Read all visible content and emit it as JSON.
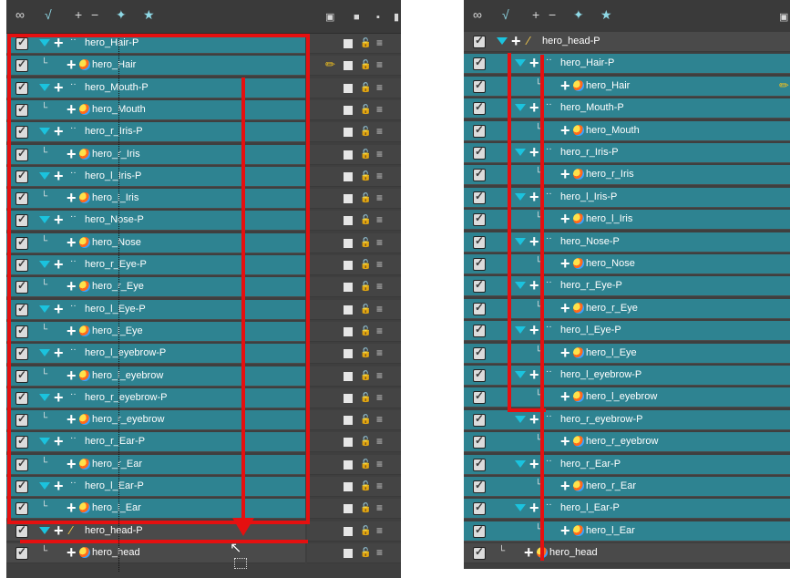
{
  "left": {
    "toolbar": {
      "icons": [
        "onion-skin-icon",
        "lightbox-icon",
        "add-layer-icon",
        "delete-layer-icon",
        "add-peg-icon",
        "add-drawing-icon"
      ],
      "right_icons": [
        "camera-view-icon",
        "display-icon",
        "small-square-icon",
        "layer-color-icon",
        "back-arrow-icon"
      ]
    },
    "rows": [
      {
        "name": "hero_Hair-P",
        "type": "peg"
      },
      {
        "name": "hero_Hair",
        "type": "drawing",
        "selected": true
      },
      {
        "name": "hero_Mouth-P",
        "type": "peg"
      },
      {
        "name": "hero_Mouth",
        "type": "drawing"
      },
      {
        "name": "hero_r_Iris-P",
        "type": "peg"
      },
      {
        "name": "hero_r_Iris",
        "type": "drawing"
      },
      {
        "name": "hero_l_Iris-P",
        "type": "peg"
      },
      {
        "name": "hero_l_Iris",
        "type": "drawing"
      },
      {
        "name": "hero_Nose-P",
        "type": "peg"
      },
      {
        "name": "hero_Nose",
        "type": "drawing"
      },
      {
        "name": "hero_r_Eye-P",
        "type": "peg"
      },
      {
        "name": "hero_r_Eye",
        "type": "drawing"
      },
      {
        "name": "hero_l_Eye-P",
        "type": "peg"
      },
      {
        "name": "hero_l_Eye",
        "type": "drawing"
      },
      {
        "name": "hero_l_eyebrow-P",
        "type": "peg"
      },
      {
        "name": "hero_l_eyebrow",
        "type": "drawing"
      },
      {
        "name": "hero_r_eyebrow-P",
        "type": "peg"
      },
      {
        "name": "hero_r_eyebrow",
        "type": "drawing"
      },
      {
        "name": "hero_r_Ear-P",
        "type": "peg"
      },
      {
        "name": "hero_r_Ear",
        "type": "drawing"
      },
      {
        "name": "hero_l_Ear-P",
        "type": "peg"
      },
      {
        "name": "hero_l_Ear",
        "type": "drawing"
      },
      {
        "name": "hero_head-P",
        "type": "head-peg"
      },
      {
        "name": "hero_head",
        "type": "drawing-dark"
      }
    ]
  },
  "right": {
    "toolbar": {
      "icons": [
        "onion-skin-icon",
        "lightbox-icon",
        "add-layer-icon",
        "delete-layer-icon",
        "add-peg-icon",
        "add-drawing-icon",
        "camera-view-icon"
      ]
    },
    "rows": [
      {
        "name": "hero_head-P",
        "type": "head-peg",
        "depth": 0
      },
      {
        "name": "hero_Hair-P",
        "type": "peg",
        "depth": 1
      },
      {
        "name": "hero_Hair",
        "type": "drawing",
        "depth": 2,
        "selected": true
      },
      {
        "name": "hero_Mouth-P",
        "type": "peg",
        "depth": 1
      },
      {
        "name": "hero_Mouth",
        "type": "drawing",
        "depth": 2
      },
      {
        "name": "hero_r_Iris-P",
        "type": "peg",
        "depth": 1
      },
      {
        "name": "hero_r_Iris",
        "type": "drawing",
        "depth": 2
      },
      {
        "name": "hero_l_Iris-P",
        "type": "peg",
        "depth": 1
      },
      {
        "name": "hero_l_Iris",
        "type": "drawing",
        "depth": 2
      },
      {
        "name": "hero_Nose-P",
        "type": "peg",
        "depth": 1
      },
      {
        "name": "hero_Nose",
        "type": "drawing",
        "depth": 2
      },
      {
        "name": "hero_r_Eye-P",
        "type": "peg",
        "depth": 1
      },
      {
        "name": "hero_r_Eye",
        "type": "drawing",
        "depth": 2
      },
      {
        "name": "hero_l_Eye-P",
        "type": "peg",
        "depth": 1
      },
      {
        "name": "hero_l_Eye",
        "type": "drawing",
        "depth": 2
      },
      {
        "name": "hero_l_eyebrow-P",
        "type": "peg",
        "depth": 1
      },
      {
        "name": "hero_l_eyebrow",
        "type": "drawing",
        "depth": 2
      },
      {
        "name": "hero_r_eyebrow-P",
        "type": "peg",
        "depth": 1
      },
      {
        "name": "hero_r_eyebrow",
        "type": "drawing",
        "depth": 2
      },
      {
        "name": "hero_r_Ear-P",
        "type": "peg",
        "depth": 1
      },
      {
        "name": "hero_r_Ear",
        "type": "drawing",
        "depth": 2
      },
      {
        "name": "hero_l_Ear-P",
        "type": "peg",
        "depth": 1
      },
      {
        "name": "hero_l_Ear",
        "type": "drawing",
        "depth": 2
      },
      {
        "name": "hero_head",
        "type": "drawing-dark",
        "depth": 0
      }
    ]
  },
  "colors": {
    "layer_teal": "#2e8391",
    "panel_bg": "#3f3f3f",
    "annotation_red": "#e51010",
    "expand_triangle": "#1bc3de"
  }
}
